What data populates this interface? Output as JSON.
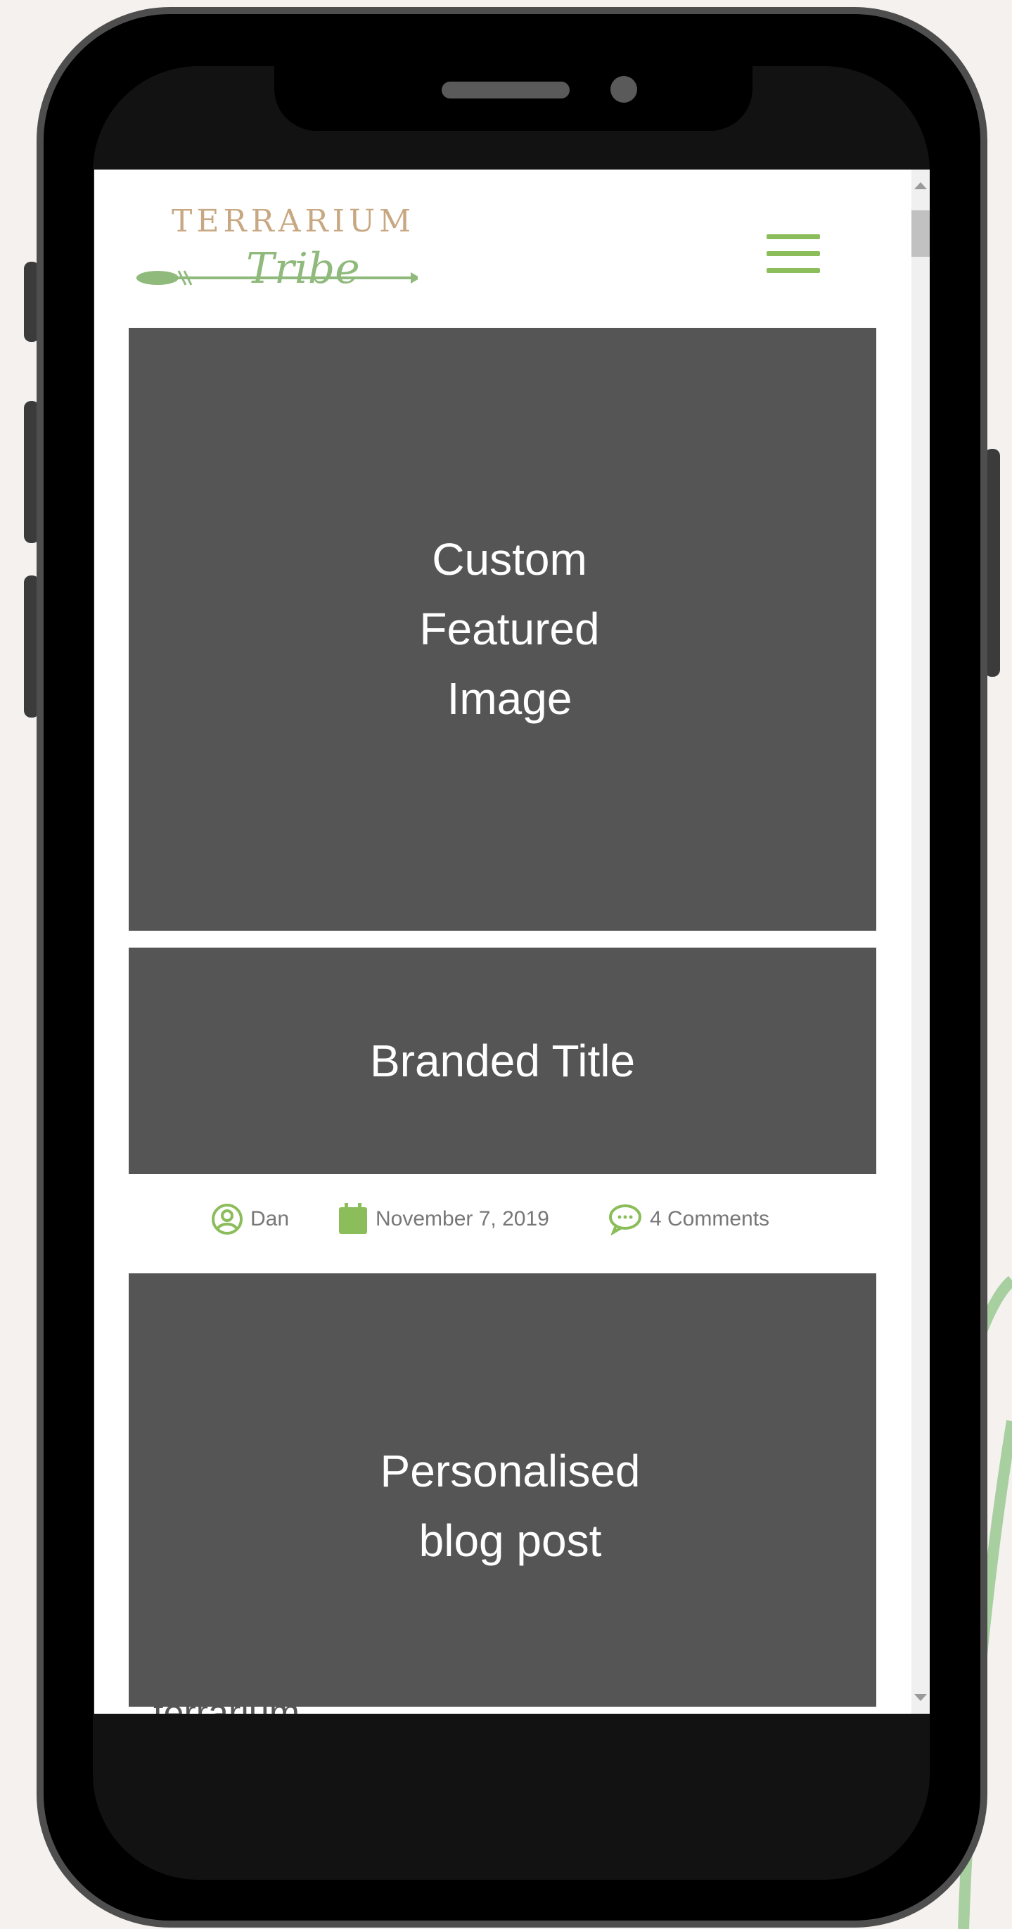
{
  "logo": {
    "top_text": "TERRARIUM",
    "script_text": "Tribe",
    "accent_gold": "#c8a882",
    "accent_green": "#8fba7c"
  },
  "header": {
    "menu_icon": "hamburger-menu-icon",
    "menu_color": "#8bbd5a"
  },
  "featured_image": {
    "label": "Custom\nFeatured\nImage"
  },
  "branded_title": {
    "label": "Branded Title"
  },
  "post_meta": {
    "author": "Dan",
    "date": "November 7, 2019",
    "comments": "4 Comments",
    "icon_color": "#8bbd5a"
  },
  "blog_post": {
    "label": "Personalised\nblog post"
  },
  "cut_off_text": "terrarium."
}
